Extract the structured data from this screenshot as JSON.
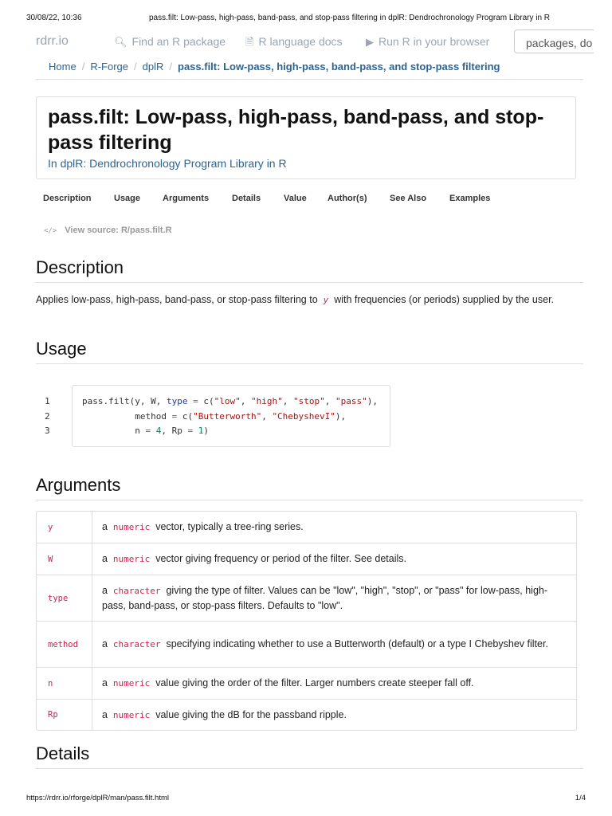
{
  "print_header": {
    "timestamp": "30/08/22, 10:36",
    "doc_title": "pass.filt: Low-pass, high-pass, band-pass, and stop-pass filtering in dplR: Dendrochronology Program Library in R"
  },
  "nav": {
    "brand": "rdrr.io",
    "find_package": "Find an R package",
    "language_docs": "R language docs",
    "run_r": "Run R in your browser",
    "search_placeholder": "packages, do"
  },
  "breadcrumb": {
    "home": "Home",
    "rforge": "R-Forge",
    "package": "dplR",
    "current": "pass.filt: Low-pass, high-pass, band-pass, and stop-pass filtering"
  },
  "page": {
    "title": "pass.filt: Low-pass, high-pass, band-pass, and stop-pass filtering",
    "in_prefix": "In",
    "in_link": "dplR: Dendrochronology Program Library in R"
  },
  "tabs": [
    "Description",
    "Usage",
    "Arguments",
    "Details",
    "Value",
    "Author(s)",
    "See Also",
    "Examples"
  ],
  "view_source": {
    "label": "View source: R/pass.filt.R"
  },
  "description": {
    "heading": "Description",
    "text_before": "Applies low-pass, high-pass, band-pass, or stop-pass filtering to",
    "code": "y",
    "text_after": "with frequencies (or periods) supplied by the user."
  },
  "usage": {
    "heading": "Usage",
    "line_numbers": [
      "1",
      "2",
      "3"
    ]
  },
  "arguments": {
    "heading": "Arguments",
    "rows": [
      {
        "name": "y",
        "prefix": "a",
        "type": "numeric",
        "desc": "vector, typically a tree-ring series."
      },
      {
        "name": "W",
        "prefix": "a",
        "type": "numeric",
        "desc": "vector giving frequency or period of the filter. See details."
      },
      {
        "name": "type",
        "prefix": "a",
        "type": "character",
        "desc": "giving the type of filter. Values can be \"low\", \"high\", \"stop\", or \"pass\" for low-pass, high-pass, band-pass, or stop-pass filters. Defaults to \"low\"."
      },
      {
        "name": "method",
        "prefix": "a",
        "type": "character",
        "desc": "specifying indicating whether to use a Butterworth (default) or a type I Chebyshev filter."
      },
      {
        "name": "n",
        "prefix": "a",
        "type": "numeric",
        "desc": "value giving the order of the filter. Larger numbers create steeper fall off."
      },
      {
        "name": "Rp",
        "prefix": "a",
        "type": "numeric",
        "desc": "value giving the dB for the passband ripple."
      }
    ]
  },
  "details": {
    "heading": "Details"
  },
  "print_footer": {
    "url": "https://rdrr.io/rforge/dplR/man/pass.filt.html",
    "page": "1/4"
  }
}
